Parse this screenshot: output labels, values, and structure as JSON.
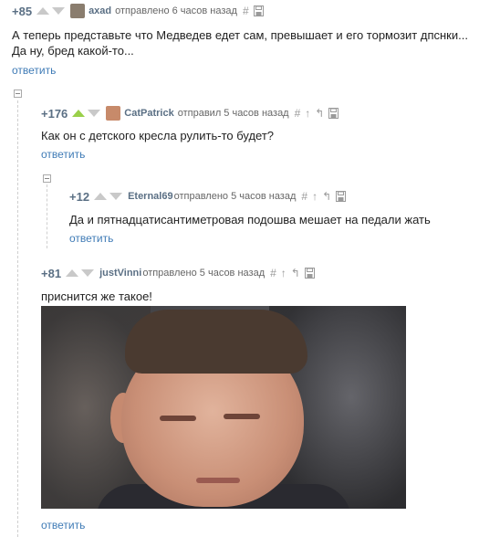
{
  "comments": [
    {
      "rating": "+85",
      "author": "axad",
      "posted": "отправлено 6 часов назад",
      "text_lines": [
        "А теперь представьте что Медведев едет сам, превышает и его тормозит дпснки...",
        "Да ну, бред какой-то..."
      ],
      "reply_label": "ответить",
      "avatar_color": "#8a7d6e",
      "upvoted": false
    },
    {
      "rating": "+176",
      "author": "CatPatrick",
      "posted": "отправил 5 часов назад",
      "text_lines": [
        "Как он с детского кресла рулить-то будет?"
      ],
      "reply_label": "ответить",
      "avatar_color": "#c78a6a",
      "upvoted": true
    },
    {
      "rating": "+12",
      "author": "Eternal69",
      "posted": "отправлено 5 часов назад",
      "text_lines": [
        "Да и пятнадцатисантиметровая подошва мешает на педали жать"
      ],
      "reply_label": "ответить",
      "upvoted": false
    },
    {
      "rating": "+81",
      "author": "justVinni",
      "posted": "отправлено 5 часов назад",
      "text_lines": [
        "приснится же такое!"
      ],
      "reply_label": "ответить",
      "upvoted": false
    }
  ],
  "icons": {
    "hash": "#",
    "up": "↑",
    "parent": "↰"
  },
  "colors": {
    "rating": "#5a6f84",
    "link": "#3f7bb6",
    "upvote_active": "#9ad04a"
  }
}
